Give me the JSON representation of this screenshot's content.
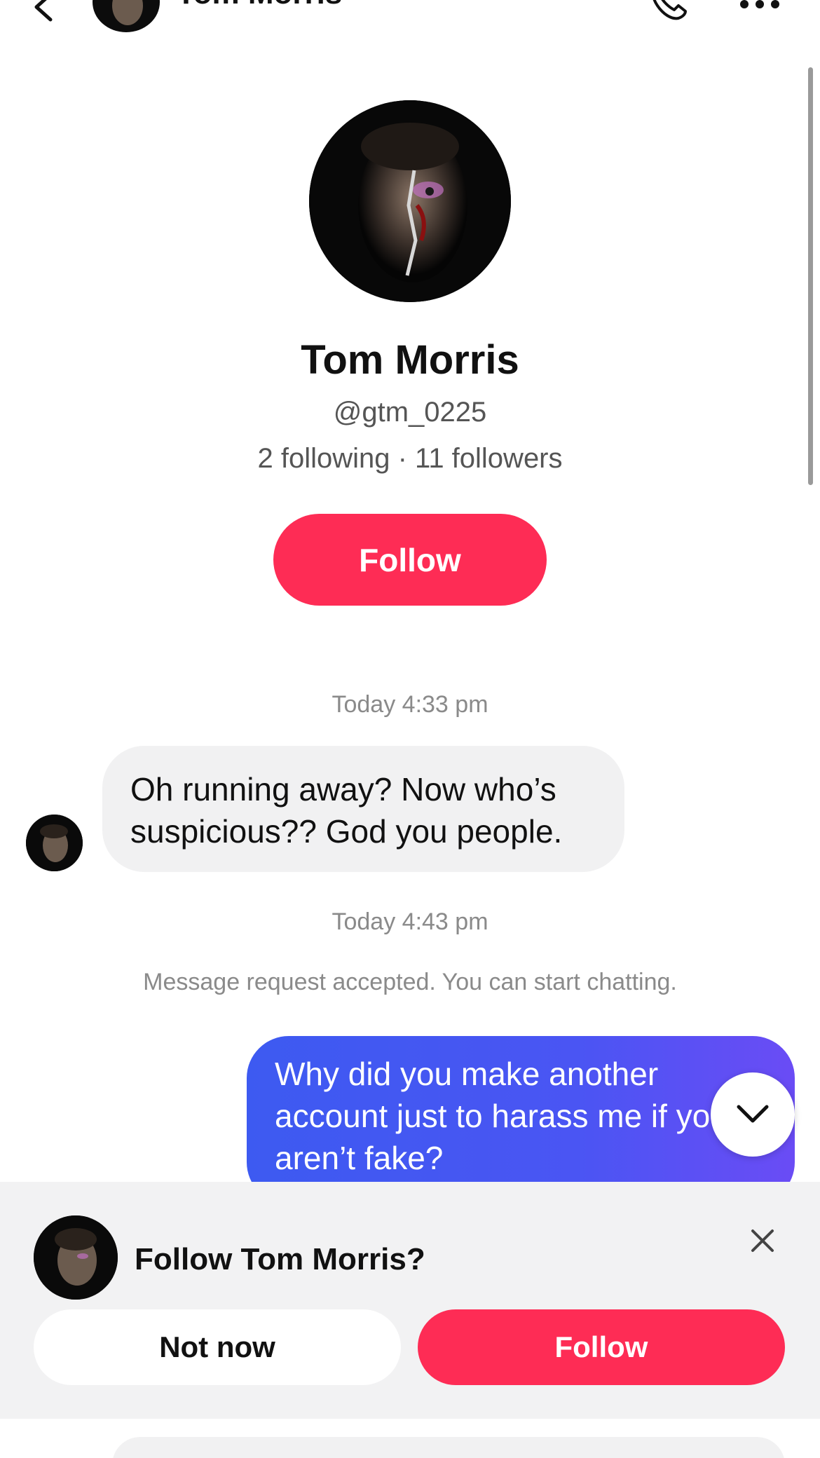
{
  "header": {
    "name": "Tom Morris",
    "icons": {
      "back": "chevron-left-icon",
      "call": "phone-icon",
      "more": "more-icon"
    }
  },
  "profile": {
    "name": "Tom Morris",
    "handle": "@gtm_0225",
    "stats": "2 following · 11 followers",
    "follow_label": "Follow"
  },
  "chat": {
    "timestamp_1": "Today 4:33 pm",
    "incoming_message": "Oh running away? Now who’s suspicious?? God you people.",
    "timestamp_2": "Today 4:43 pm",
    "system_note": "Message request accepted. You can start chatting.",
    "outgoing_message": "Why did you make another account just to harass me if you aren’t fake?"
  },
  "follow_prompt": {
    "text": "Follow Tom Morris?",
    "not_now_label": "Not now",
    "follow_label": "Follow"
  },
  "colors": {
    "accent": "#fe2c55",
    "outgoing_bubble": "#3d5af1",
    "incoming_bubble": "#f1f1f2",
    "panel": "#f2f2f3"
  }
}
